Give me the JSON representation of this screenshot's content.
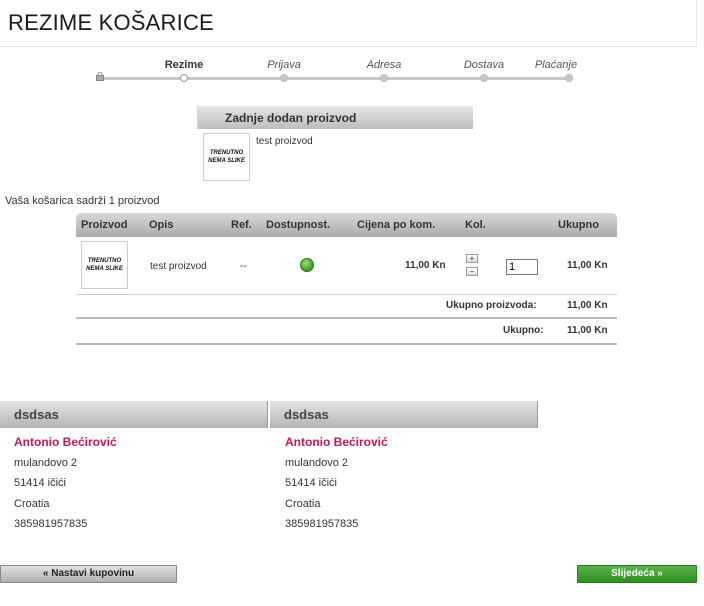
{
  "page": {
    "title": "REZIME KOŠARICE"
  },
  "steps": [
    {
      "label": "Rezime",
      "active": true
    },
    {
      "label": "Prijava",
      "active": false
    },
    {
      "label": "Adresa",
      "active": false
    },
    {
      "label": "Dostava",
      "active": false
    },
    {
      "label": "Plaćanje",
      "active": false
    }
  ],
  "last_added": {
    "header": "Zadnje dodan proizvod",
    "image_text": "TRENUTNO NEMA SLIKE",
    "product_name": "test proizvod"
  },
  "cart_summary": "Vaša košarica sadrži 1 proizvod",
  "table": {
    "columns": [
      "Proizvod",
      "Opis",
      "Ref.",
      "Dostupnost.",
      "Cijena po kom.",
      "Kol.",
      "Ukupno"
    ],
    "rows": [
      {
        "image_text": "TRENUTNO NEMA SLIKE",
        "description": "test proizvod",
        "ref": "--",
        "availability": "available",
        "unit_price": "11,00 Kn",
        "quantity": "1",
        "total": "11,00 Kn"
      }
    ],
    "plus_label": "+",
    "minus_label": "−",
    "subtotal_label": "Ukupno proizvoda:",
    "subtotal_value": "11,00 Kn",
    "total_label": "Ukupno:",
    "total_value": "11,00 Kn"
  },
  "addresses": [
    {
      "header": "dsdsas",
      "name": "Antonio Bećirović",
      "street": "mulandovo 2",
      "city": "51414 ičići",
      "country": "Croatia",
      "phone": "385981957835"
    },
    {
      "header": "dsdsas",
      "name": "Antonio Bećirović",
      "street": "mulandovo 2",
      "city": "51414 ičići",
      "country": "Croatia",
      "phone": "385981957835"
    }
  ],
  "buttons": {
    "back": "« Nastavi kupovinu",
    "next": "Slijedeća »"
  },
  "colors": {
    "accent_name": "#c2185b",
    "next_button": "#3a9a2a",
    "available": "#3c9a1e"
  }
}
